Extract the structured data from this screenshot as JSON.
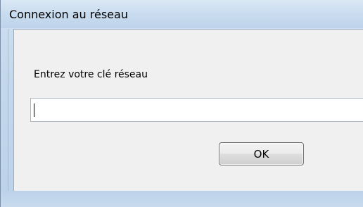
{
  "window": {
    "title": "Connexion au réseau"
  },
  "dialog": {
    "prompt": "Entrez votre clé réseau",
    "key_value": "",
    "ok_label": "OK"
  },
  "colors": {
    "frame": "#c3d7ec",
    "client": "#f0f0f0"
  }
}
